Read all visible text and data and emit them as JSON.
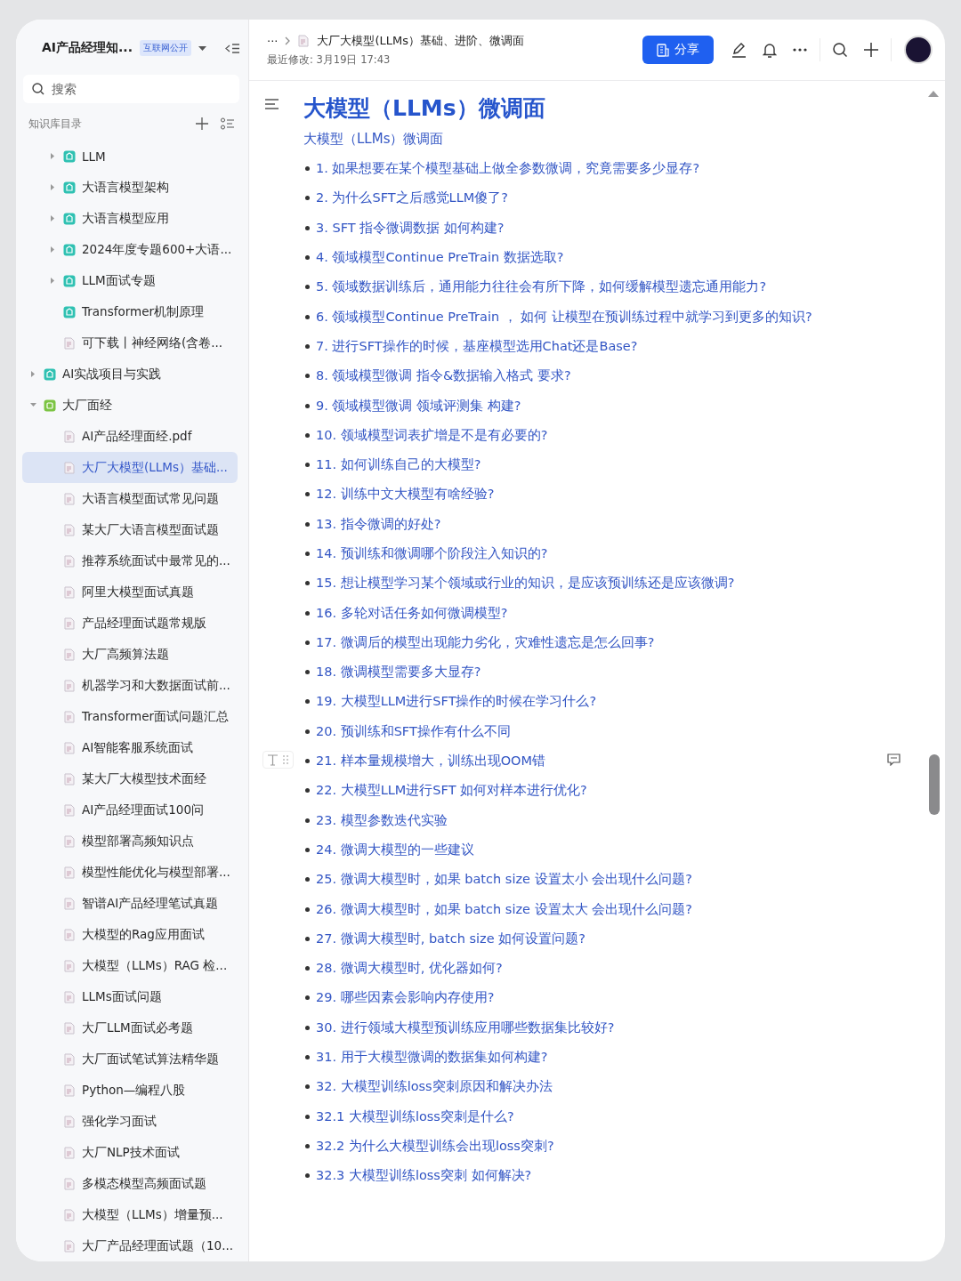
{
  "sidebar": {
    "space_title": "AI产品经理知...",
    "visibility_badge": "互联网公开",
    "search": {
      "placeholder": "搜索"
    },
    "section_title": "知识库目录",
    "tree_continued": [
      {
        "label": "LLM",
        "kind": "kb",
        "expanded": false,
        "selected": false
      },
      {
        "label": "大语言模型架构",
        "kind": "kb",
        "expanded": false,
        "selected": false
      },
      {
        "label": "大语言模型应用",
        "kind": "kb",
        "expanded": false,
        "selected": false
      },
      {
        "label": "2024年度专题600+大语...",
        "kind": "kb",
        "expanded": false,
        "selected": false
      },
      {
        "label": "LLM面试专题",
        "kind": "kb",
        "expanded": false,
        "selected": false
      },
      {
        "label": "Transformer机制原理",
        "kind": "kb",
        "selected": false
      },
      {
        "label": "可下载丨神经网络(含卷...",
        "kind": "doc",
        "selected": false
      }
    ],
    "tree": [
      {
        "label": "AI实战项目与实践",
        "kind": "kb",
        "expanded": false,
        "selected": false
      },
      {
        "label": "大厂面经",
        "kind": "folder",
        "expanded": true,
        "selected": false,
        "children": [
          {
            "label": "AI产品经理面经.pdf",
            "kind": "doc",
            "selected": false
          },
          {
            "label": "大厂大模型(LLMs）基础...",
            "kind": "doc",
            "selected": true
          },
          {
            "label": "大语言模型面试常见问题",
            "kind": "doc",
            "selected": false
          },
          {
            "label": "某大厂大语言模型面试题",
            "kind": "doc",
            "selected": false
          },
          {
            "label": "推荐系统面试中最常见的...",
            "kind": "doc",
            "selected": false
          },
          {
            "label": "阿里大模型面试真题",
            "kind": "doc",
            "selected": false
          },
          {
            "label": "产品经理面试题常规版",
            "kind": "doc",
            "selected": false
          },
          {
            "label": "大厂高频算法题",
            "kind": "doc",
            "selected": false
          },
          {
            "label": "机器学习和大数据面试前...",
            "kind": "doc",
            "selected": false
          },
          {
            "label": "Transformer面试问题汇总",
            "kind": "doc",
            "selected": false
          },
          {
            "label": "AI智能客服系统面试",
            "kind": "doc",
            "selected": false
          },
          {
            "label": "某大厂大模型技术面经",
            "kind": "doc",
            "selected": false
          },
          {
            "label": "AI产品经理面试100问",
            "kind": "doc",
            "selected": false
          },
          {
            "label": "模型部署高频知识点",
            "kind": "doc",
            "selected": false
          },
          {
            "label": "模型性能优化与模型部署...",
            "kind": "doc",
            "selected": false
          },
          {
            "label": "智谱AI产品经理笔试真题",
            "kind": "doc",
            "selected": false
          },
          {
            "label": "大模型的Rag应用面试",
            "kind": "doc",
            "selected": false
          },
          {
            "label": "大模型（LLMs）RAG 检...",
            "kind": "doc",
            "selected": false
          },
          {
            "label": "LLMs面试问题",
            "kind": "doc",
            "selected": false
          },
          {
            "label": "大厂LLM面试必考题",
            "kind": "doc",
            "selected": false
          },
          {
            "label": "大厂面试笔试算法精华题",
            "kind": "doc",
            "selected": false
          },
          {
            "label": "Python—编程八股",
            "kind": "doc",
            "selected": false
          },
          {
            "label": "强化学习面试",
            "kind": "doc",
            "selected": false
          },
          {
            "label": "大厂NLP技术面试",
            "kind": "doc",
            "selected": false
          },
          {
            "label": "多模态模型高频面试题",
            "kind": "doc",
            "selected": false
          },
          {
            "label": "大模型（LLMs）增量预...",
            "kind": "doc",
            "selected": false
          },
          {
            "label": "大厂产品经理面试题（10...",
            "kind": "doc",
            "selected": false
          }
        ]
      }
    ]
  },
  "header": {
    "ellipsis": "···",
    "breadcrumb": "大厂大模型(LLMs）基础、进阶、微调面",
    "last_modified": "最近修改: 3月19日 17:43",
    "share_button": "分享"
  },
  "document": {
    "title": "大模型（LLMs）微调面",
    "subtitle_link": "大模型（LLMs）微调面",
    "items": [
      {
        "text": "1. 如果想要在某个模型基础上做全参数微调，究竟需要多少显存?",
        "hovered": false
      },
      {
        "text": "2. 为什么SFT之后感觉LLM傻了?",
        "hovered": false
      },
      {
        "text": "3. SFT 指令微调数据 如何构建?",
        "hovered": false
      },
      {
        "text": "4. 领域模型Continue PreTrain 数据选取?",
        "hovered": false
      },
      {
        "text": "5. 领域数据训练后，通用能力往往会有所下降，如何缓解模型遗忘通用能力?",
        "hovered": false
      },
      {
        "text": "6. 领域模型Continue PreTrain ， 如何 让模型在预训练过程中就学习到更多的知识?",
        "hovered": false
      },
      {
        "text": "7. 进行SFT操作的时候，基座模型选用Chat还是Base?",
        "hovered": false
      },
      {
        "text": "8. 领域模型微调 指令&数据输入格式 要求?",
        "hovered": false
      },
      {
        "text": "9. 领域模型微调 领域评测集 构建?",
        "hovered": false
      },
      {
        "text": "10. 领域模型词表扩增是不是有必要的?",
        "hovered": false
      },
      {
        "text": "11. 如何训练自己的大模型?",
        "hovered": false
      },
      {
        "text": "12. 训练中文大模型有啥经验?",
        "hovered": false
      },
      {
        "text": "13. 指令微调的好处?",
        "hovered": false
      },
      {
        "text": "14. 预训练和微调哪个阶段注入知识的?",
        "hovered": false
      },
      {
        "text": "15. 想让模型学习某个领域或行业的知识，是应该预训练还是应该微调?",
        "hovered": false
      },
      {
        "text": "16. 多轮对话任务如何微调模型?",
        "hovered": false
      },
      {
        "text": "17. 微调后的模型出现能力劣化，灾难性遗忘是怎么回事?",
        "hovered": false
      },
      {
        "text": "18. 微调模型需要多大显存?",
        "hovered": false
      },
      {
        "text": "19. 大模型LLM进行SFT操作的时候在学习什么?",
        "hovered": false
      },
      {
        "text": "20. 预训练和SFT操作有什么不同",
        "hovered": false
      },
      {
        "text": "21. 样本量规模增大，训练出现OOM错",
        "hovered": true
      },
      {
        "text": "22. 大模型LLM进行SFT 如何对样本进行优化?",
        "hovered": false
      },
      {
        "text": "23. 模型参数迭代实验",
        "hovered": false
      },
      {
        "text": "24. 微调大模型的一些建议",
        "hovered": false
      },
      {
        "text": "25. 微调大模型时，如果 batch size 设置太小 会出现什么问题?",
        "hovered": false
      },
      {
        "text": "26. 微调大模型时，如果 batch size 设置太大 会出现什么问题?",
        "hovered": false
      },
      {
        "text": "27. 微调大模型时, batch size 如何设置问题?",
        "hovered": false
      },
      {
        "text": "28. 微调大模型时, 优化器如何?",
        "hovered": false
      },
      {
        "text": "29. 哪些因素会影响内存使用?",
        "hovered": false
      },
      {
        "text": "30. 进行领域大模型预训练应用哪些数据集比较好?",
        "hovered": false
      },
      {
        "text": "31. 用于大模型微调的数据集如何构建?",
        "hovered": false
      },
      {
        "text": "32. 大模型训练loss突刺原因和解决办法",
        "hovered": false
      },
      {
        "text": "32.1 大模型训练loss突刺是什么?",
        "hovered": false
      },
      {
        "text": "32.2 为什么大模型训练会出现loss突刺?",
        "hovered": false
      },
      {
        "text": "32.3 大模型训练loss突刺 如何解决?",
        "hovered": false
      }
    ]
  }
}
